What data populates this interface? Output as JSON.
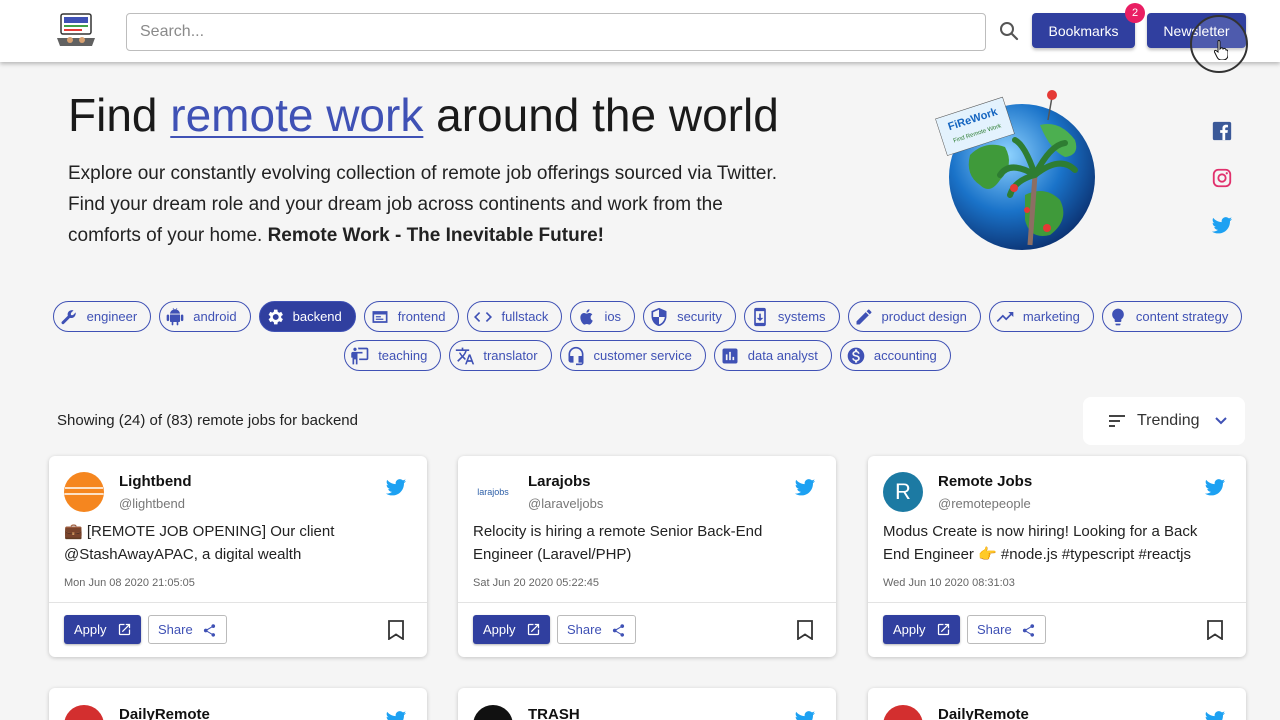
{
  "header": {
    "search_placeholder": "Search...",
    "bookmarks_label": "Bookmarks",
    "bookmarks_count": "2",
    "newsletter_label": "Newsletter",
    "logo_icon": "firework-logo-icon"
  },
  "hero": {
    "title_prefix": "Find ",
    "title_link": "remote work",
    "title_suffix": " around the world",
    "desc_line1": "Explore our constantly evolving collection of remote job offerings sourced via Twitter.",
    "desc_line2": "Find your dream role and your dream job across continents and work from the",
    "desc_line3": "comforts of your home. ",
    "desc_bold": "Remote Work - The Inevitable Future!",
    "globe_icon": "globe-illustration",
    "globe_sign_top": "FiReWork",
    "globe_sign_bottom": "Find Remote Work"
  },
  "social": [
    {
      "name": "facebook-icon",
      "color": "#3b5998"
    },
    {
      "name": "instagram-icon",
      "color": "#e1306c"
    },
    {
      "name": "twitter-icon",
      "color": "#1da1f2"
    }
  ],
  "tags_row1": [
    {
      "label": "engineer",
      "icon": "wrench-icon",
      "active": false
    },
    {
      "label": "android",
      "icon": "android-icon",
      "active": false
    },
    {
      "label": "backend",
      "icon": "gear-icon",
      "active": true
    },
    {
      "label": "frontend",
      "icon": "browser-icon",
      "active": false
    },
    {
      "label": "fullstack",
      "icon": "code-icon",
      "active": false
    },
    {
      "label": "ios",
      "icon": "apple-icon",
      "active": false
    },
    {
      "label": "security",
      "icon": "shield-icon",
      "active": false
    },
    {
      "label": "systems",
      "icon": "system-update-icon",
      "active": false
    },
    {
      "label": "product design",
      "icon": "pencil-icon",
      "active": false
    },
    {
      "label": "marketing",
      "icon": "trending-up-icon",
      "active": false
    },
    {
      "label": "content strategy",
      "icon": "lightbulb-icon",
      "active": false
    }
  ],
  "tags_row2": [
    {
      "label": "teaching",
      "icon": "teacher-icon",
      "active": false
    },
    {
      "label": "translator",
      "icon": "translate-icon",
      "active": false
    },
    {
      "label": "customer service",
      "icon": "headset-icon",
      "active": false
    },
    {
      "label": "data analyst",
      "icon": "bar-chart-icon",
      "active": false
    },
    {
      "label": "accounting",
      "icon": "dollar-icon",
      "active": false
    }
  ],
  "listing": {
    "showing_text": "Showing (24) of (83) remote jobs for backend",
    "sort_label": "Trending"
  },
  "cards": [
    {
      "name": "Lightbend",
      "handle": "@lightbend",
      "avatar_type": "lightbend",
      "text_line1": "💼 [REMOTE JOB OPENING] Our client",
      "text_line2": "@StashAwayAPAC, a digital wealth",
      "date": "Mon Jun 08 2020 21:05:05",
      "apply_label": "Apply",
      "share_label": "Share"
    },
    {
      "name": "Larajobs",
      "handle": "@laraveljobs",
      "avatar_type": "larajobs",
      "avatar_text": "larajobs",
      "text_line1": "Relocity is hiring a remote Senior Back-End",
      "text_line2": "Engineer (Laravel/PHP)",
      "date": "Sat Jun 20 2020 05:22:45",
      "apply_label": "Apply",
      "share_label": "Share"
    },
    {
      "name": "Remote Jobs",
      "handle": "@remotepeople",
      "avatar_type": "letter",
      "avatar_text": "R",
      "text_line1": "Modus Create is now hiring! Looking for a Back",
      "text_line2": "End Engineer 👉 #node.js #typescript #reactjs",
      "date": "Wed Jun 10 2020 08:31:03",
      "apply_label": "Apply",
      "share_label": "Share"
    }
  ],
  "cards_partial": [
    {
      "name": "DailyRemote"
    },
    {
      "name": "TRASH"
    },
    {
      "name": "DailyRemote"
    }
  ]
}
